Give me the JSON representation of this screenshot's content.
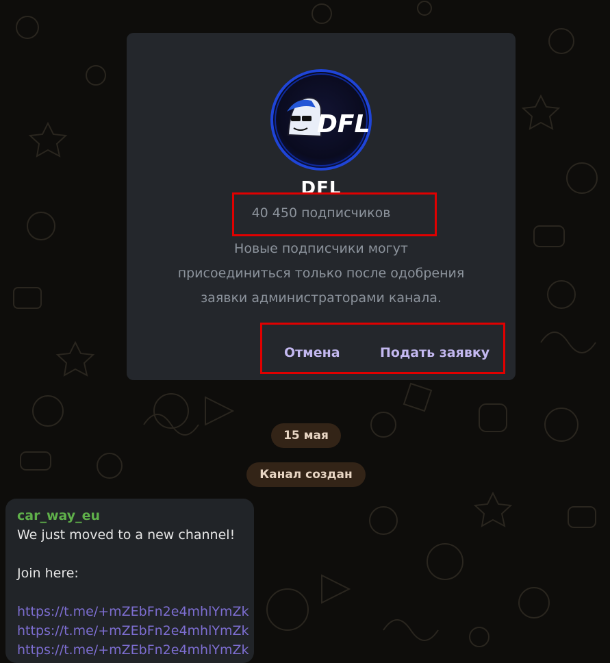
{
  "channel": {
    "title": "DFL",
    "logo_text": "DFL",
    "subscribers": "40 450 подписчиков",
    "description_lines": [
      "Новые подписчики могут",
      "присоединиться только после одобрения",
      "заявки администраторами канала."
    ]
  },
  "dialog_buttons": {
    "cancel": "Отмена",
    "apply": "Подать заявку"
  },
  "service_messages": {
    "date": "15 мая",
    "created": "Канал создан"
  },
  "message": {
    "author": "car_way_eu",
    "lines": [
      "We just moved to a new channel!",
      "Join here:"
    ],
    "links": [
      "https://t.me/+mZEbFn2e4mhlYmZk",
      "https://t.me/+mZEbFn2e4mhlYmZk",
      "https://t.me/+mZEbFn2e4mhlYmZk"
    ]
  },
  "colors": {
    "accent": "#c3b8f0",
    "highlight": "#e00000",
    "author": "#5fb04a",
    "link": "#7d6ed1"
  }
}
